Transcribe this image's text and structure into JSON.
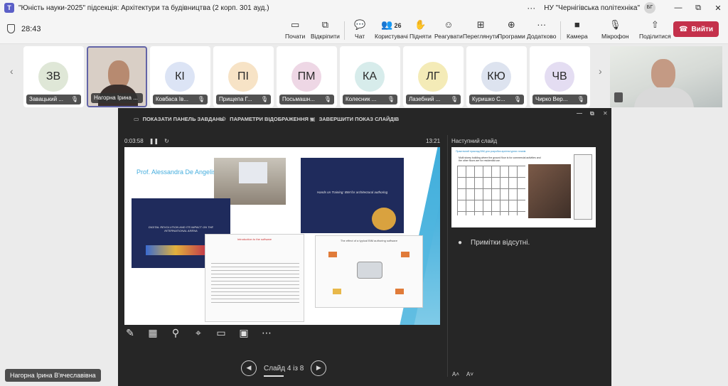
{
  "window": {
    "title": "\"Юність науки-2025\" підсекція: Архітектури та будівництва (2 корп. 301 ауд.)",
    "more": "···",
    "org": "НУ \"Чернігівська політехніка\"",
    "user_initials": "БГ",
    "minimize": "—",
    "restore": "⧉",
    "close": "✕"
  },
  "toolbar": {
    "timer": "28:43",
    "items": [
      {
        "label": "Почати",
        "icon": "▭"
      },
      {
        "label": "Відкріпити",
        "icon": "⧉"
      },
      {
        "label": "Чат",
        "icon": "💬"
      },
      {
        "label": "Користувачі",
        "icon": "👥",
        "count": "26"
      },
      {
        "label": "Підняти",
        "icon": "✋"
      },
      {
        "label": "Реагувати",
        "icon": "☺"
      },
      {
        "label": "Переглянути",
        "icon": "⊞"
      },
      {
        "label": "Програми",
        "icon": "⊕"
      },
      {
        "label": "Додатково",
        "icon": "···"
      },
      {
        "label": "Камера",
        "icon": "■"
      },
      {
        "label": "Мікрофон",
        "icon": "🎙"
      },
      {
        "label": "Поділитися",
        "icon": "⇧"
      }
    ],
    "leave_label": "Вийти"
  },
  "participants": [
    {
      "initials": "ЗВ",
      "name": "Завацький ...",
      "color": "#dfe7d7"
    },
    {
      "initials": "",
      "name": "Нагорна Ірина ...",
      "color": ""
    },
    {
      "initials": "КІ",
      "name": "Ковбаса Ів...",
      "color": "#dce4f5"
    },
    {
      "initials": "ПІ",
      "name": "Прищепа Г...",
      "color": "#f7e3c6"
    },
    {
      "initials": "ПМ",
      "name": "Посьмашн...",
      "color": "#eed7e5"
    },
    {
      "initials": "КА",
      "name": "Колесник ...",
      "color": "#d7eceb"
    },
    {
      "initials": "ЛГ",
      "name": "Лазебний ...",
      "color": "#f4ebb7"
    },
    {
      "initials": "КЮ",
      "name": "Куришко С...",
      "color": "#dde3ef"
    },
    {
      "initials": "ЧВ",
      "name": "Чирко Вер...",
      "color": "#e4ddf2"
    }
  ],
  "presenter": {
    "top_items": [
      "ПОКАЗАТИ ПАНЕЛЬ ЗАВДАНЬ",
      "ПАРАМЕТРИ ВІДОБРАЖЕННЯ ▾",
      "ЗАВЕРШИТИ ПОКАЗ СЛАЙДІВ"
    ],
    "elapsed": "0:03:58",
    "clock": "13:21",
    "slide_title": "Prof. Alessandra De Angelis",
    "navy1_title": "DIGITAL REVOLUTION AND ITS IMPACT ON THE INTERNATIONAL ARENA",
    "navy2_title": "Hands on Training: BIM for architectural authoring",
    "paper1_title": "Introduction to the software",
    "paper2_title": "The effect of a typical BIM authoring software",
    "next_label": "Наступний слайд",
    "next_title": "Практичний приклад BIM для розробки архітектурних планів",
    "next_body": "Multi storey building where the ground floor is for commercial activities and the other floors are for residential use.",
    "notes": "Примітки відсутні.",
    "slide_counter": "Слайд 4 із 8",
    "font_up": "A˄",
    "font_down": "A˅"
  },
  "presenter_name": "Нагорна Ірина В'ячеславівна"
}
